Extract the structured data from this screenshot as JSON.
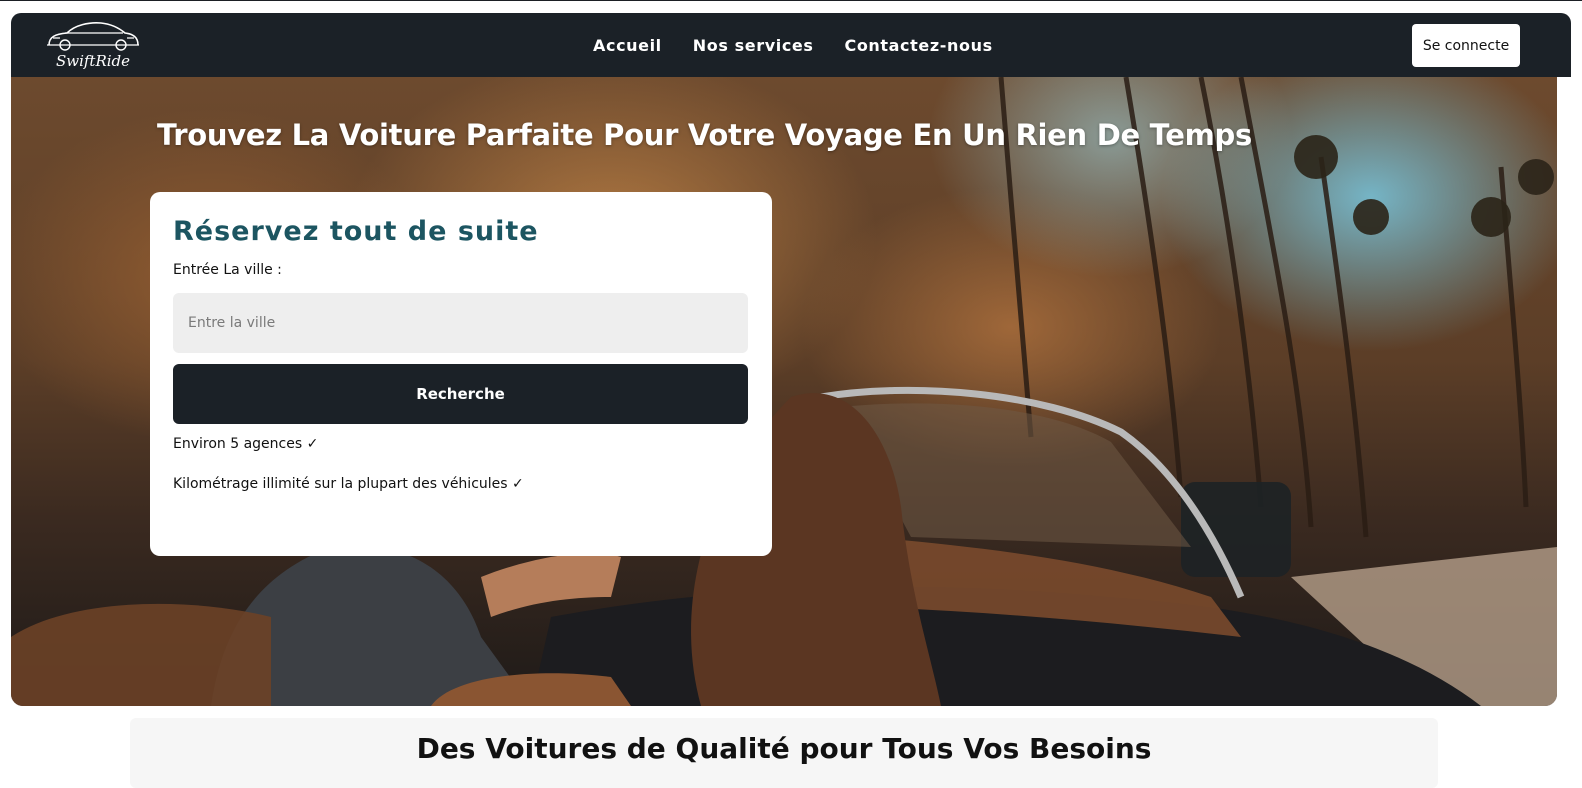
{
  "brand": {
    "name": "SwiftRide"
  },
  "nav": {
    "links": [
      "Accueil",
      "Nos services",
      "Contactez-nous"
    ],
    "connect_label": "Se connecte"
  },
  "hero": {
    "title": "Trouvez La Voiture Parfaite Pour Votre Voyage En Un Rien De Temps"
  },
  "booking": {
    "title": "Réservez tout de suite",
    "city_label": "Entrée La ville :",
    "city_placeholder": "Entre la ville",
    "city_value": "",
    "search_label": "Recherche",
    "features": [
      "Environ 5 agences ✓",
      "Kilométrage illimité sur la plupart des véhicules ✓"
    ]
  },
  "section": {
    "heading": "Des Voitures de Qualité pour Tous Vos Besoins"
  },
  "colors": {
    "navbar": "#1b2127",
    "card_title": "#1c5561",
    "button_dark": "#1b2127",
    "input_bg": "#eeeeee"
  },
  "icons": {
    "logo": "car-outline-icon",
    "check": "checkmark-icon"
  }
}
